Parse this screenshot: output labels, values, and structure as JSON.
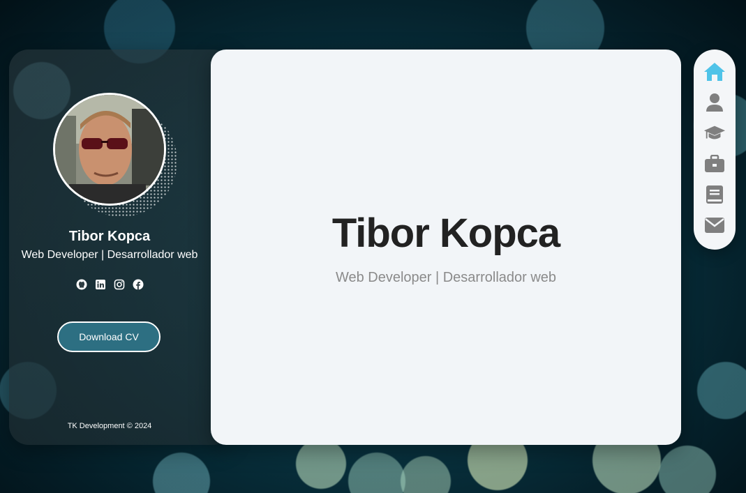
{
  "profile": {
    "name": "Tibor Kopca",
    "role": "Web Developer | Desarrollador web",
    "download_cv_label": "Download CV",
    "copyright": "TK Development © 2024"
  },
  "socials": [
    "github-icon",
    "linkedin-icon",
    "instagram-icon",
    "facebook-icon"
  ],
  "hero": {
    "title": "Tibor Kopca",
    "subtitle": "Web Developer | Desarrollador web"
  },
  "nav": {
    "items": [
      "home-icon",
      "user-icon",
      "graduation-cap-icon",
      "briefcase-icon",
      "book-icon",
      "envelope-icon"
    ],
    "active": "home-icon"
  },
  "colors": {
    "accent": "#4fc3e8",
    "nav_inactive": "#7f7f7f",
    "button": "#2d6f82",
    "hero_title": "#222222",
    "hero_subtitle": "#8a8a8a"
  }
}
